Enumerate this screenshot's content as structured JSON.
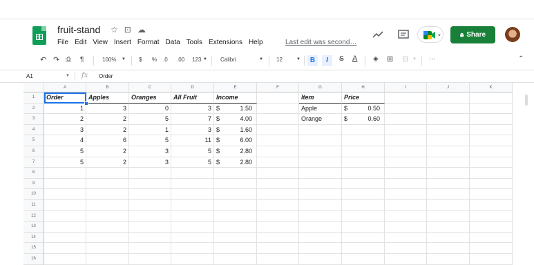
{
  "document": {
    "title": "fruit-stand",
    "last_edit": "Last edit was second…"
  },
  "menu": [
    "File",
    "Edit",
    "View",
    "Insert",
    "Format",
    "Data",
    "Tools",
    "Extensions",
    "Help"
  ],
  "share_label": "Share",
  "toolbar": {
    "zoom": "100%",
    "currency": "$",
    "percent": "%",
    "dec_decrease": ".0",
    "dec_increase": ".00",
    "more_formats": "123",
    "font": "Calibri",
    "font_size": "12",
    "bold": "B",
    "italic": "I",
    "strike": "S",
    "text_color": "A",
    "more": "···"
  },
  "formula_bar": {
    "cell_ref": "A1",
    "fx": "fx",
    "value": "Order"
  },
  "columns": [
    "A",
    "B",
    "C",
    "D",
    "E",
    "F",
    "G",
    "H",
    "I",
    "J",
    "K"
  ],
  "rows": [
    "1",
    "2",
    "3",
    "4",
    "5",
    "6",
    "7",
    "8",
    "9",
    "10",
    "11",
    "12",
    "13",
    "14",
    "15",
    "16"
  ],
  "table1": {
    "headers": [
      "Order",
      "Apples",
      "Oranges",
      "All Fruit",
      "Income"
    ],
    "rows": [
      {
        "order": "1",
        "apples": "3",
        "oranges": "0",
        "all": "3",
        "cur": "$",
        "income": "1.50"
      },
      {
        "order": "2",
        "apples": "2",
        "oranges": "5",
        "all": "7",
        "cur": "$",
        "income": "4.00"
      },
      {
        "order": "3",
        "apples": "2",
        "oranges": "1",
        "all": "3",
        "cur": "$",
        "income": "1.60"
      },
      {
        "order": "4",
        "apples": "6",
        "oranges": "5",
        "all": "11",
        "cur": "$",
        "income": "6.00"
      },
      {
        "order": "5",
        "apples": "2",
        "oranges": "3",
        "all": "5",
        "cur": "$",
        "income": "2.80"
      },
      {
        "order": "5",
        "apples": "2",
        "oranges": "3",
        "all": "5",
        "cur": "$",
        "income": "2.80"
      }
    ]
  },
  "table2": {
    "headers": [
      "Item",
      "Price"
    ],
    "rows": [
      {
        "item": "Apple",
        "cur": "$",
        "price": "0.50"
      },
      {
        "item": "Orange",
        "cur": "$",
        "price": "0.60"
      }
    ]
  },
  "accent": "#1a73e8",
  "share_color": "#188038"
}
